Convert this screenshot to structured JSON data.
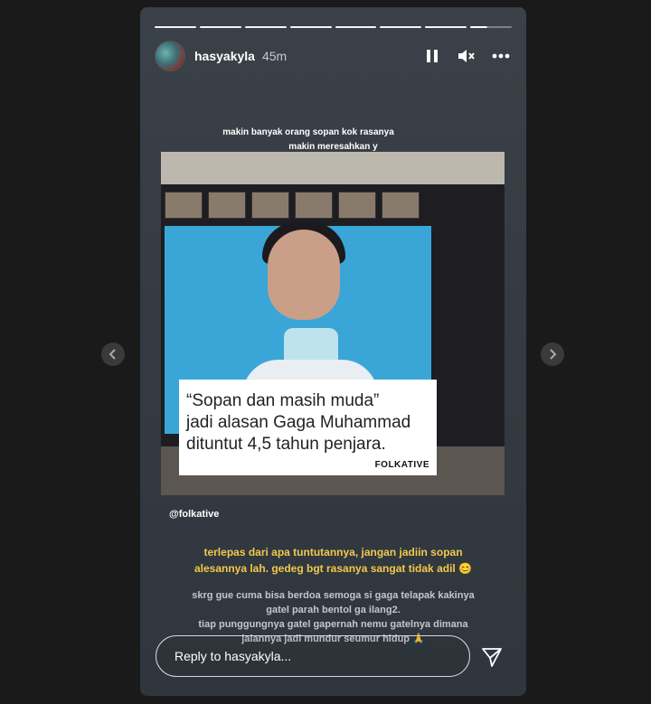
{
  "header": {
    "username": "hasyakyla",
    "time": "45m"
  },
  "progress_segments": 8,
  "story": {
    "top_caption_line1": "makin banyak orang sopan kok rasanya",
    "top_caption_line2": "makin meresahkan y",
    "quote_line1": "“Sopan dan masih muda”",
    "quote_line2": "jadi alasan Gaga Muhammad",
    "quote_line3": "dituntut 4,5 tahun penjara.",
    "brand": "FOLKATIVE",
    "mention": "@folkative",
    "yellow_line1": "terlepas dari apa tuntutannya, jangan jadiin sopan",
    "yellow_line2": "alesannya lah. gedeg bgt rasanya sangat tidak adil 😊",
    "grey_line1": "skrg gue cuma bisa berdoa semoga si gaga telapak kakinya",
    "grey_line2": "gatel parah bentol ga ilang2.",
    "grey_line3": "tiap punggungnya gatel gapernah nemu gatelnya dimana",
    "grey_line4": "jalannya jadi mundur seumur hidup 🙏"
  },
  "reply": {
    "placeholder": "Reply to hasyakyla..."
  },
  "icons": {
    "pause": "pause-icon",
    "mute": "mute-icon",
    "more": "more-icon",
    "send": "send-icon",
    "prev": "chevron-left-icon",
    "next": "chevron-right-icon"
  },
  "colors": {
    "caption_yellow": "#f2c94c",
    "background": "#1a1a1a"
  }
}
